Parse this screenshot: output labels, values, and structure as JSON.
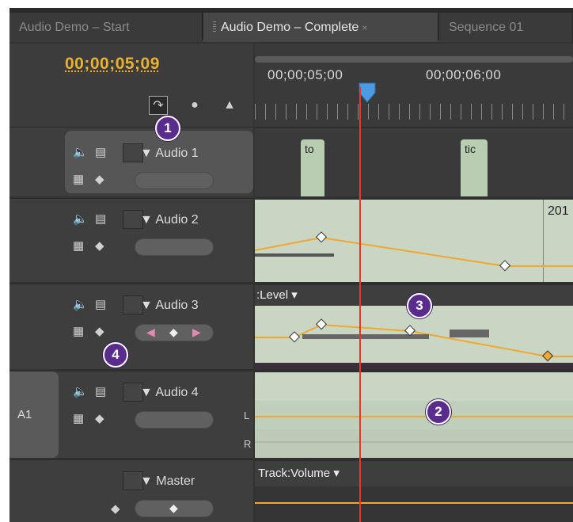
{
  "tabs": [
    {
      "label": "Audio Demo – Start",
      "active": false
    },
    {
      "label": "Audio Demo – Complete",
      "active": true,
      "close": "×"
    },
    {
      "label": "Sequence 01",
      "active": false
    }
  ],
  "timecode": "00;00;05;09",
  "ruler": {
    "times": [
      "00;00;05;00",
      "00;00;06;00"
    ]
  },
  "tracks": [
    {
      "name": "Audio 1",
      "clip_labels": [
        "to",
        "tic"
      ]
    },
    {
      "name": "Audio 2",
      "clip_label": "201"
    },
    {
      "name": "Audio 3",
      "dropdown": ":Level"
    },
    {
      "name": "Audio 4",
      "target": "A1",
      "channels": [
        "L",
        "R"
      ]
    },
    {
      "name": "Master",
      "dropdown": "Track:Volume"
    }
  ],
  "callouts": [
    "1",
    "2",
    "3",
    "4"
  ],
  "colors": {
    "timecode": "#e8b230",
    "playhead": "#e03a2a",
    "keyframe_line": "#f0a830",
    "callout": "#5a2d8c"
  }
}
